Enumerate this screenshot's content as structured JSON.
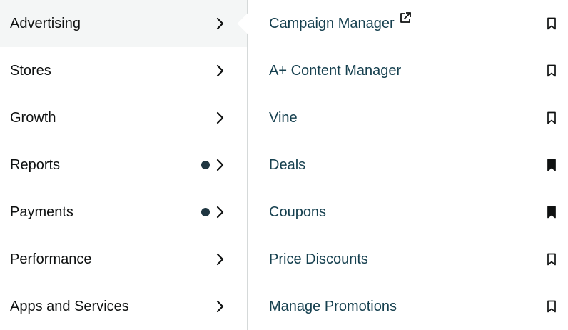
{
  "left_menu": {
    "items": [
      {
        "label": "Advertising",
        "active": true,
        "dot": false
      },
      {
        "label": "Stores",
        "active": false,
        "dot": false
      },
      {
        "label": "Growth",
        "active": false,
        "dot": false
      },
      {
        "label": "Reports",
        "active": false,
        "dot": true
      },
      {
        "label": "Payments",
        "active": false,
        "dot": true
      },
      {
        "label": "Performance",
        "active": false,
        "dot": false
      },
      {
        "label": "Apps and Services",
        "active": false,
        "dot": false
      }
    ]
  },
  "submenu": {
    "items": [
      {
        "label": "Campaign Manager",
        "external": true,
        "bookmarked": false
      },
      {
        "label": "A+ Content Manager",
        "external": false,
        "bookmarked": false
      },
      {
        "label": "Vine",
        "external": false,
        "bookmarked": false
      },
      {
        "label": "Deals",
        "external": false,
        "bookmarked": true
      },
      {
        "label": "Coupons",
        "external": false,
        "bookmarked": true
      },
      {
        "label": "Price Discounts",
        "external": false,
        "bookmarked": false
      },
      {
        "label": "Manage Promotions",
        "external": false,
        "bookmarked": false
      }
    ]
  },
  "colors": {
    "text_primary": "#0f1111",
    "text_link": "#16404f",
    "active_bg": "#f4f6f6",
    "dot": "#1f3641",
    "divider": "#d5d9d9"
  },
  "icons": {
    "chevron": "chevron-right-icon",
    "dot": "notification-dot-icon",
    "external": "external-link-icon",
    "bookmark_outline": "bookmark-outline-icon",
    "bookmark_filled": "bookmark-filled-icon"
  }
}
